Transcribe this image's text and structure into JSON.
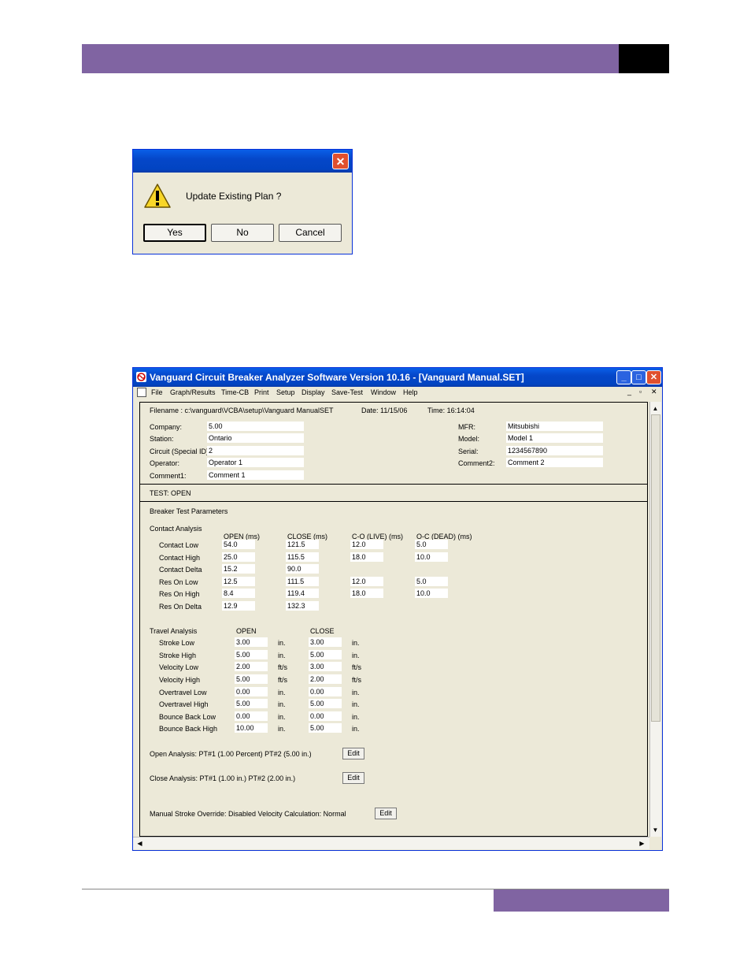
{
  "dialog": {
    "message": "Update Existing Plan ?",
    "buttons": [
      "Yes",
      "No",
      "Cancel"
    ],
    "close_glyph": "✕"
  },
  "app": {
    "title": "Vanguard Circuit Breaker Analyzer Software Version 10.16 - [Vanguard Manual.SET]",
    "menus": [
      "File",
      "Graph/Results",
      "Time-CB",
      "Print",
      "Setup",
      "Display",
      "Save-Test",
      "Window",
      "Help"
    ]
  },
  "file_info": {
    "filename": "Filename : c:\\vanguard\\VCBA\\setup\\Vanguard ManualSET",
    "date": "Date: 11/15/06",
    "time": "Time: 16:14:04"
  },
  "fields_left": [
    {
      "label": "Company:",
      "value": "5.00"
    },
    {
      "label": "Station:",
      "value": "Ontario"
    },
    {
      "label": "Circuit (Special ID):",
      "value": "2"
    },
    {
      "label": "Operator:",
      "value": "Operator 1"
    },
    {
      "label": "Comment1:",
      "value": "Comment 1"
    }
  ],
  "fields_right": [
    {
      "label": "MFR:",
      "value": "Mitsubishi"
    },
    {
      "label": "Model:",
      "value": "Model 1"
    },
    {
      "label": "Serial:",
      "value": "1234567890"
    },
    {
      "label": "Comment2:",
      "value": "Comment 2"
    }
  ],
  "test_label": "TEST: OPEN",
  "params_title": "Breaker Test Parameters",
  "contact": {
    "title": "Contact Analysis",
    "headers": [
      "OPEN (ms)",
      "CLOSE (ms)",
      "C-O (LIVE) (ms)",
      "O-C (DEAD) (ms)"
    ],
    "rows": [
      {
        "label": "Contact Low",
        "v": [
          "54.0",
          "121.5",
          "12.0",
          "5.0"
        ]
      },
      {
        "label": "Contact High",
        "v": [
          "25.0",
          "115.5",
          "18.0",
          "10.0"
        ]
      },
      {
        "label": "Contact Delta",
        "v": [
          "15.2",
          "90.0",
          "",
          ""
        ]
      },
      {
        "label": "Res On Low",
        "v": [
          "12.5",
          "111.5",
          "12.0",
          "5.0"
        ]
      },
      {
        "label": "Res On High",
        "v": [
          "8.4",
          "119.4",
          "18.0",
          "10.0"
        ]
      },
      {
        "label": "Res On Delta",
        "v": [
          "12.9",
          "132.3",
          "",
          ""
        ]
      }
    ]
  },
  "travel": {
    "title": "Travel Analysis",
    "headers": [
      "OPEN",
      "CLOSE"
    ],
    "rows": [
      {
        "label": "Stroke Low",
        "open": "3.00",
        "ou": "in.",
        "close": "3.00",
        "cu": "in."
      },
      {
        "label": "Stroke High",
        "open": "5.00",
        "ou": "in.",
        "close": "5.00",
        "cu": "in."
      },
      {
        "label": "Velocity Low",
        "open": "2.00",
        "ou": "ft/s",
        "close": "3.00",
        "cu": "ft/s"
      },
      {
        "label": "Velocity High",
        "open": "5.00",
        "ou": "ft/s",
        "close": "2.00",
        "cu": "ft/s"
      },
      {
        "label": "Overtravel Low",
        "open": "0.00",
        "ou": "in.",
        "close": "0.00",
        "cu": "in."
      },
      {
        "label": "Overtravel High",
        "open": "5.00",
        "ou": "in.",
        "close": "5.00",
        "cu": "in."
      },
      {
        "label": "Bounce Back Low",
        "open": "0.00",
        "ou": "in.",
        "close": "0.00",
        "cu": "in."
      },
      {
        "label": "Bounce Back High",
        "open": "10.00",
        "ou": "in.",
        "close": "5.00",
        "cu": "in."
      }
    ]
  },
  "open_analysis": "Open  Analysis:  PT#1 (1.00 Percent)    PT#2 (5.00 in.)",
  "close_analysis": "Close Analysis:  PT#1 (1.00 in.)    PT#2 (2.00 in.)",
  "manual_stroke": "Manual Stroke Override: Disabled  Velocity Calculation:  Normal",
  "edit_label": "Edit"
}
